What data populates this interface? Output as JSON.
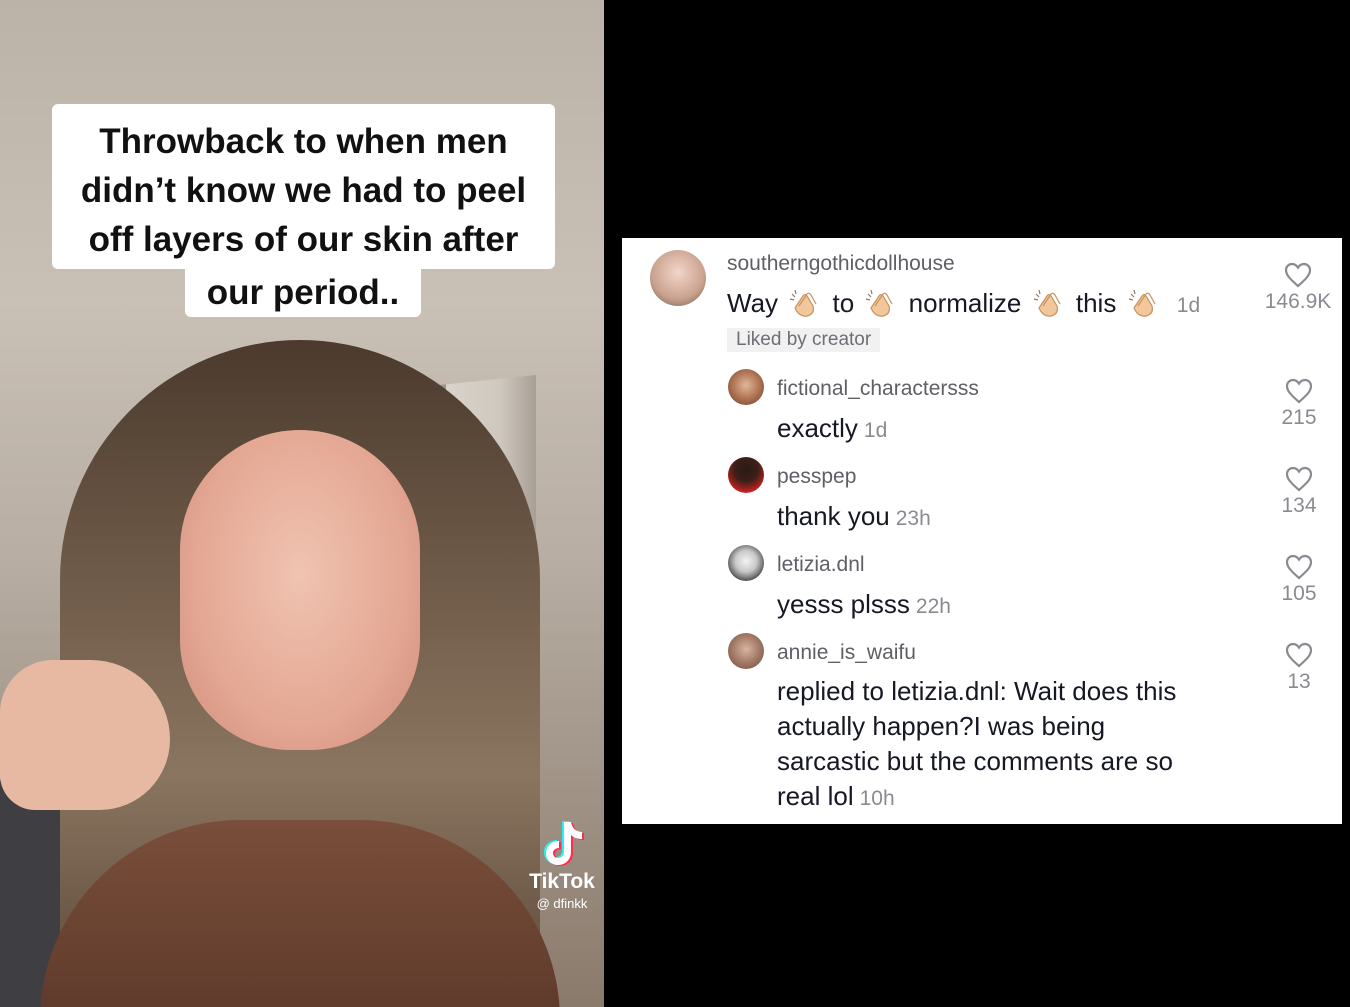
{
  "video": {
    "caption_lines": [
      "Throwback to when men",
      "didn’t know we had to peel",
      "off layers of our skin after",
      "our period.."
    ],
    "watermark": {
      "brand": "TikTok",
      "handle": "@ dfinkk"
    }
  },
  "comments": {
    "main": {
      "username": "southerngothicdollhouse",
      "text_words": [
        "Way",
        "to",
        "normalize",
        "this"
      ],
      "emoji_icon": "clapping-hands-emoji",
      "time": "1d",
      "badge": "Liked by creator",
      "likes": "146.9K"
    },
    "replies": [
      {
        "username": "fictional_charactersss",
        "text": "exactly",
        "time": "1d",
        "likes": "215"
      },
      {
        "username": "pesspep",
        "text": "thank you",
        "time": "23h",
        "likes": "134"
      },
      {
        "username": "letizia.dnl",
        "text": "yesss plsss",
        "time": "22h",
        "likes": "105"
      },
      {
        "username": "annie_is_waifu",
        "prefix": "replied to ",
        "mention": "letizia.dnl",
        "lines": [
          ": Wait does this",
          "actually happen?I was being",
          "sarcastic but the comments are so",
          "real lol"
        ],
        "time": "10h",
        "likes": "13"
      }
    ],
    "colors": {
      "text": "#161823",
      "muted": "#8a8b91",
      "username": "#5f5f66",
      "badge_bg": "#f1f1f2"
    }
  }
}
